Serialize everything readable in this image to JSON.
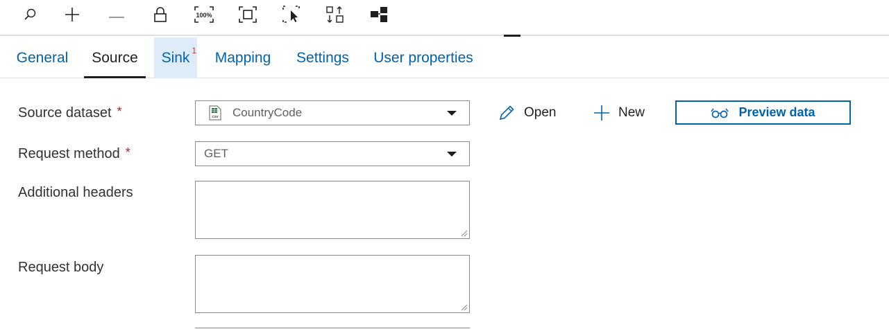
{
  "toolbar": {
    "icons": [
      "search-icon",
      "zoom-in-icon",
      "zoom-out-icon",
      "lock-icon",
      "zoom-100-icon",
      "fit-to-window-icon",
      "select-icon",
      "auto-align-icon",
      "layout-icon"
    ],
    "zoom_100_label": "100%"
  },
  "tabs": [
    {
      "label": "General",
      "active": false
    },
    {
      "label": "Source",
      "active": true
    },
    {
      "label": "Sink",
      "active": false,
      "badge": "1"
    },
    {
      "label": "Mapping",
      "active": false
    },
    {
      "label": "Settings",
      "active": false
    },
    {
      "label": "User properties",
      "active": false
    }
  ],
  "form": {
    "source_dataset": {
      "label": "Source dataset",
      "required_mark": "*",
      "value": "CountryCode",
      "icon": "csv-file-icon",
      "icon_text": "CSV"
    },
    "request_method": {
      "label": "Request method",
      "required_mark": "*",
      "value": "GET"
    },
    "additional_headers": {
      "label": "Additional headers",
      "value": ""
    },
    "request_body": {
      "label": "Request body",
      "value": ""
    }
  },
  "actions": {
    "open_label": "Open",
    "new_label": "New",
    "preview_label": "Preview data"
  },
  "colors": {
    "link": "#0062ad",
    "active_tab": "#201f1e",
    "required": "#a4262c",
    "badge": "#d13438",
    "highlight_tab_bg": "#deecf9",
    "field_border": "#8a8886"
  }
}
